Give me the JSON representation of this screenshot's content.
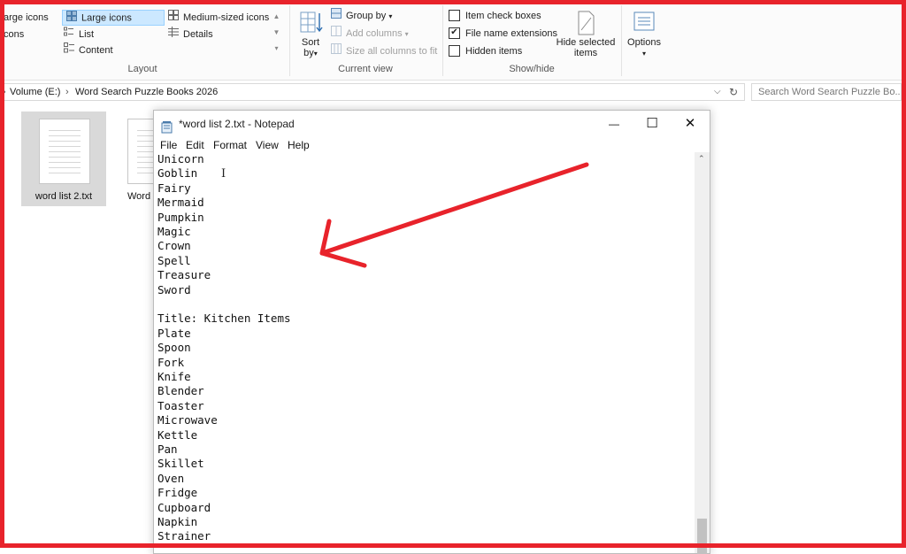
{
  "ribbon": {
    "layout": {
      "items": [
        "arge icons",
        "Large icons",
        "Medium-sized icons",
        "cons",
        "List",
        "Details",
        "Content"
      ],
      "label": "Layout"
    },
    "current_view": {
      "sort_line1": "Sort",
      "sort_line2": "by",
      "group_by": "Group by",
      "add_columns": "Add columns",
      "size_all_columns": "Size all columns to fit",
      "label": "Current view"
    },
    "show_hide": {
      "item_check_boxes": "Item check boxes",
      "file_name_extensions": "File name extensions",
      "hidden_items": "Hidden items",
      "hide_selected_line1": "Hide selected",
      "hide_selected_line2": "items",
      "label": "Show/hide",
      "checks": {
        "item_check_boxes": false,
        "file_name_extensions": true,
        "hidden_items": false
      }
    },
    "options": "Options"
  },
  "address": {
    "volume": "Volume (E:)",
    "separator": "›",
    "folder": "Word Search Puzzle Books 2026"
  },
  "search": {
    "placeholder": "Search Word Search Puzzle Bo..."
  },
  "files": [
    {
      "name": "word list 2.txt",
      "selected": true
    },
    {
      "name": "Word",
      "selected": false
    }
  ],
  "notepad": {
    "title": "*word list 2.txt - Notepad",
    "menu": [
      "File",
      "Edit",
      "Format",
      "View",
      "Help"
    ],
    "window_controls": {
      "minimize": "—",
      "maximize": "☐",
      "close": "✕"
    },
    "lines": [
      "Unicorn",
      "Goblin",
      "Fairy",
      "Mermaid",
      "Pumpkin",
      "Magic",
      "Crown",
      "Spell",
      "Treasure",
      "Sword",
      "",
      "Title: Kitchen Items",
      "Plate",
      "Spoon",
      "Fork",
      "Knife",
      "Blender",
      "Toaster",
      "Microwave",
      "Kettle",
      "Pan",
      "Skillet",
      "Oven",
      "Fridge",
      "Cupboard",
      "Napkin",
      "Strainer"
    ]
  },
  "colors": {
    "annotation": "#e8232b",
    "selection": "#cce8ff"
  }
}
